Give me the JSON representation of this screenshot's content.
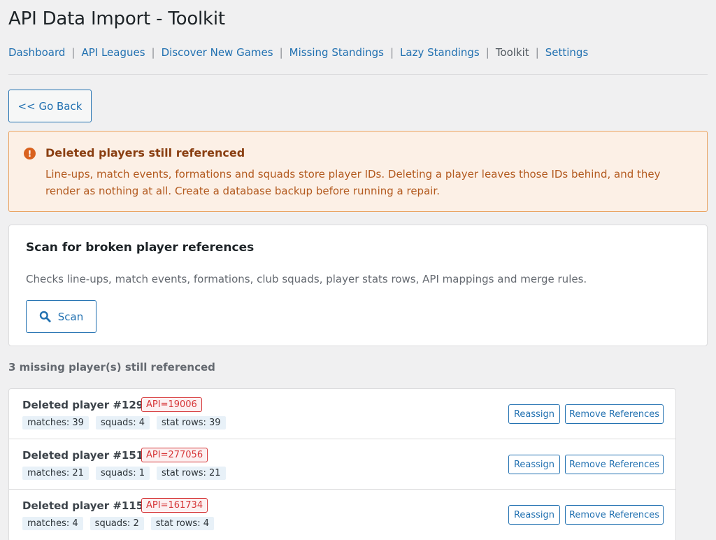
{
  "page": {
    "title": "API Data Import - Toolkit"
  },
  "nav": {
    "items": [
      {
        "label": "Dashboard",
        "current": false
      },
      {
        "label": "API Leagues",
        "current": false
      },
      {
        "label": "Discover New Games",
        "current": false
      },
      {
        "label": "Missing Standings",
        "current": false
      },
      {
        "label": "Lazy Standings",
        "current": false
      },
      {
        "label": "Toolkit",
        "current": true
      },
      {
        "label": "Settings",
        "current": false
      }
    ],
    "separator": "|"
  },
  "back_button": {
    "label": "<< Go Back"
  },
  "notice": {
    "icon": "exclamation-circle-icon",
    "icon_glyph": "!",
    "title": "Deleted players still referenced",
    "body": "Line-ups, match events, formations and squads store player IDs. Deleting a player leaves those IDs behind, and they render as nothing at all. Create a database backup before running a repair.",
    "color": "#d9621f"
  },
  "scan_card": {
    "title": "Scan for broken player references",
    "description": "Checks line-ups, match events, formations, club squads, player stats rows, API mappings and merge rules.",
    "scan_button": {
      "label": "Scan",
      "icon": "search-icon"
    }
  },
  "missing": {
    "heading": "3 missing player(s) still referenced",
    "players": [
      {
        "name": "Deleted player #1295",
        "api": "API=19006",
        "matches": "matches: 39",
        "squads": "squads: 4",
        "stat_rows": "stat rows: 39"
      },
      {
        "name": "Deleted player #1511",
        "api": "API=277056",
        "matches": "matches: 21",
        "squads": "squads: 1",
        "stat_rows": "stat rows: 21"
      },
      {
        "name": "Deleted player #1155",
        "api": "API=161734",
        "matches": "matches: 4",
        "squads": "squads: 2",
        "stat_rows": "stat rows: 4"
      }
    ],
    "reassign_label": "Reassign",
    "remove_label": "Remove References"
  },
  "colors": {
    "accent": "#2271b1",
    "warning": "#d9621f",
    "danger": "#d63638"
  }
}
